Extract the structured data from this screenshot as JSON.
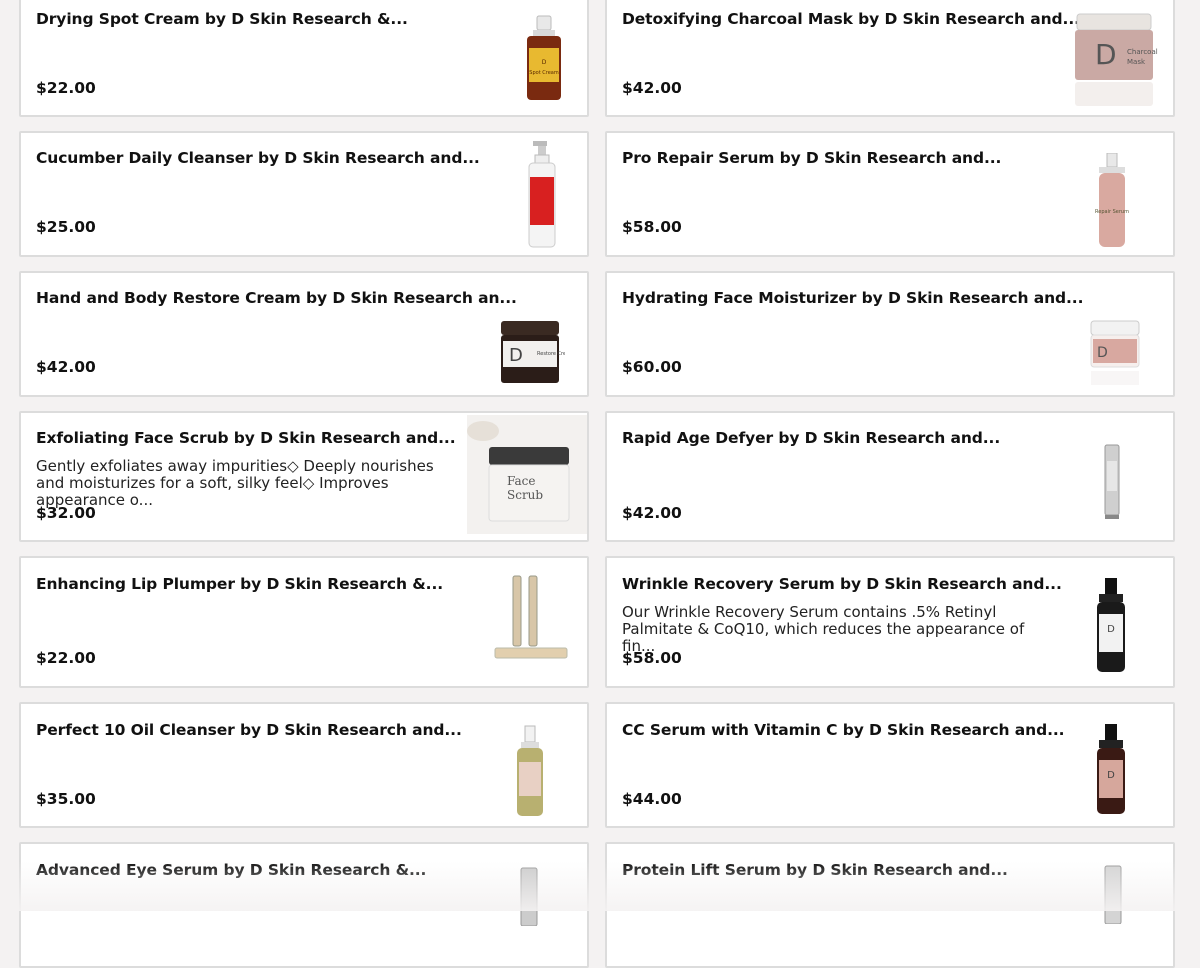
{
  "products": [
    {
      "title": "Drying Spot Cream by D Skin Research &...",
      "price": "$22.00",
      "description": "",
      "image": "dropper-bottle-amber-icon"
    },
    {
      "title": "Detoxifying Charcoal Mask by D Skin Research and...",
      "price": "$42.00",
      "description": "",
      "image": "charcoal-mask-jar-icon"
    },
    {
      "title": "Cucumber Daily Cleanser by D Skin Research and...",
      "price": "$25.00",
      "description": "",
      "image": "pump-bottle-red-label-icon"
    },
    {
      "title": "Pro Repair Serum by D Skin Research and...",
      "price": "$58.00",
      "description": "",
      "image": "serum-pump-bottle-pink-icon"
    },
    {
      "title": "Hand and Body Restore Cream by D Skin Research an...",
      "price": "$42.00",
      "description": "",
      "image": "dark-cream-jar-icon"
    },
    {
      "title": "Hydrating Face Moisturizer by D Skin Research and...",
      "price": "$60.00",
      "description": "",
      "image": "white-moisturizer-jar-icon"
    },
    {
      "title": "Exfoliating Face Scrub by D Skin Research and...",
      "price": "$32.00",
      "description": "Gently exfoliates away impurities◇ Deeply nourishes and moisturizes for a soft, silky feel◇ Improves appearance o...",
      "image": "face-scrub-jar-icon"
    },
    {
      "title": "Rapid Age Defyer by D Skin Research and...",
      "price": "$42.00",
      "description": "",
      "image": "slim-silver-tube-icon"
    },
    {
      "title": "Enhancing Lip Plumper by D Skin Research &...",
      "price": "$22.00",
      "description": "",
      "image": "lip-plumper-tubes-icon"
    },
    {
      "title": "Wrinkle Recovery Serum by D Skin Research and...",
      "price": "$58.00",
      "description": "Our Wrinkle Recovery Serum contains .5% Retinyl Palmitate & CoQ10, which reduces the appearance of fin...",
      "image": "black-serum-pump-white-label-icon"
    },
    {
      "title": "Perfect 10 Oil Cleanser by D Skin Research and...",
      "price": "$35.00",
      "description": "",
      "image": "oil-cleanser-pump-bottle-icon"
    },
    {
      "title": "CC Serum with Vitamin C by D Skin Research and...",
      "price": "$44.00",
      "description": "",
      "image": "black-serum-pump-pink-label-icon"
    },
    {
      "title": "Advanced Eye Serum by D Skin Research &...",
      "price": "",
      "description": "",
      "image": "eye-serum-tube-icon"
    },
    {
      "title": "Protein Lift Serum by D Skin Research and...",
      "price": "",
      "description": "",
      "image": "protein-lift-tube-icon"
    }
  ]
}
